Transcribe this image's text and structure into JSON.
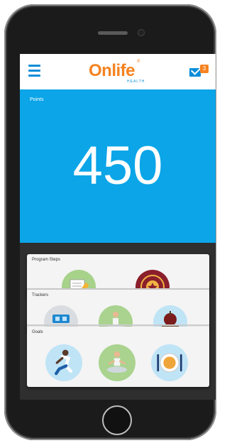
{
  "header": {
    "logo_text_on": "On",
    "logo_text_life": "life",
    "logo_registered": "®",
    "logo_subtext": "HEALTH",
    "mail_badge_count": "3"
  },
  "points": {
    "label": "Points",
    "value": "450"
  },
  "cards": [
    {
      "title": "Program Steps",
      "icons": [
        "notepad-pencil-icon",
        "medal-icon"
      ]
    },
    {
      "title": "Trackers",
      "icons": [
        "scale-icon",
        "meditation-icon",
        "apple-icon"
      ]
    },
    {
      "title": "Goals",
      "icons": [
        "runner-icon",
        "meditation-icon",
        "plate-icon"
      ]
    }
  ],
  "colors": {
    "brand_orange": "#f6821f",
    "brand_blue": "#0b8ed8",
    "points_bg": "#0ba5e8",
    "cards_bg": "#2f2f2f"
  }
}
